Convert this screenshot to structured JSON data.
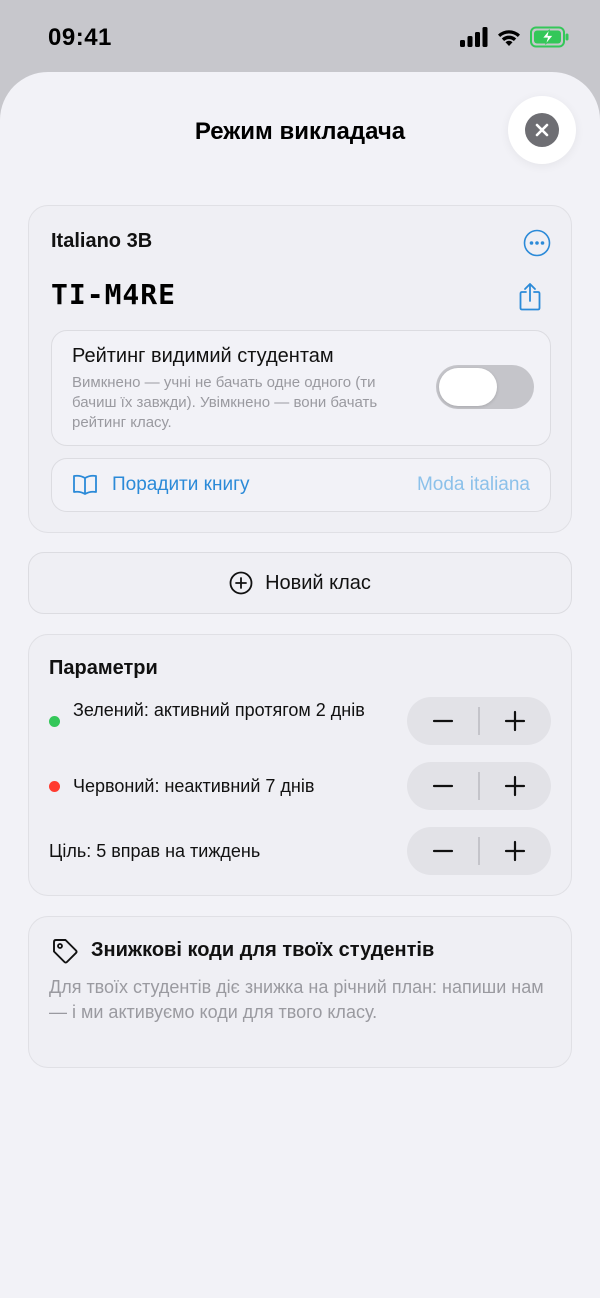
{
  "status_bar": {
    "time": "09:41",
    "icons": [
      "signal-icon",
      "wifi-icon",
      "battery-charging-icon"
    ],
    "battery_color": "#34c759"
  },
  "sheet": {
    "title": "Режим викладача",
    "close_icon": "close-icon"
  },
  "class_card": {
    "name": "Italiano 3B",
    "code": "TI-M4RE",
    "more_icon": "ellipsis-circle-icon",
    "share_icon": "share-icon",
    "leaderboard": {
      "title": "Рейтинг видимий студентам",
      "description": "Вимкнено — учні не бачать одне одного (ти бачиш їх завжди). Увімкнено — вони бачать рейтинг класу.",
      "enabled": false
    },
    "recommend_book": {
      "icon": "book-icon",
      "label": "Порадити книгу",
      "value": "Moda italiana"
    }
  },
  "new_class_button": {
    "icon": "plus-circle-icon",
    "label": "Новий клас"
  },
  "params": {
    "title": "Параметри",
    "rows": [
      {
        "label": "Зелений: активний протягом 2 днів",
        "dot_color": "#34c759"
      },
      {
        "label": "Червоний: неактивний 7 днів",
        "dot_color": "#ff3b30"
      },
      {
        "label": "Ціль: 5 вправ на тиждень",
        "dot_color": null
      }
    ],
    "stepper_minus": "−",
    "stepper_plus": "+"
  },
  "discount": {
    "icon": "tag-icon",
    "title": "Знижкові коди для твоїх студентів",
    "description": "Для твоїх студентів діє знижка на річний план: напиши нам — і ми активуємо коди для твого класу."
  },
  "colors": {
    "accent": "#2b8ad8",
    "accent_light": "#8cc1ea",
    "secondary_text": "#9a9aa0",
    "sheet_bg": "#f2f2f7"
  }
}
